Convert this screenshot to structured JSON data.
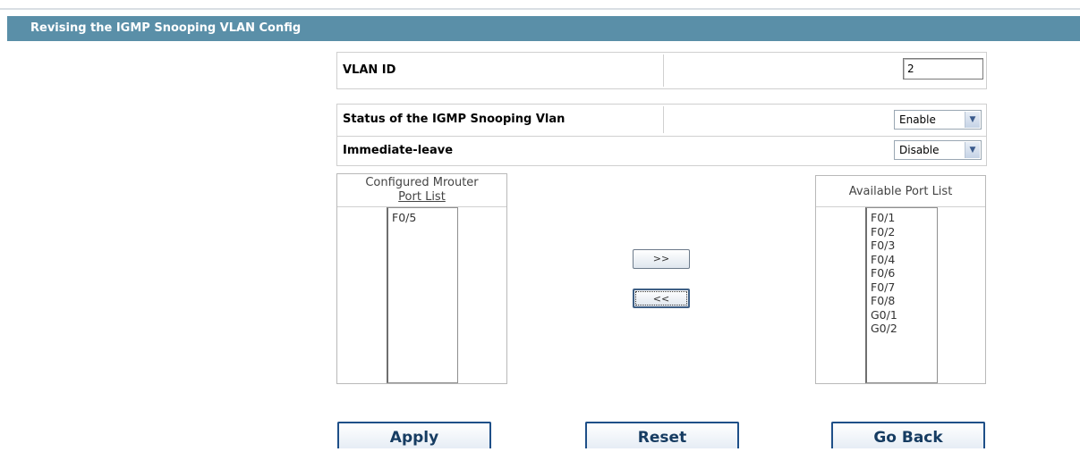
{
  "header": {
    "title": "Revising the IGMP Snooping VLAN Config"
  },
  "vlan": {
    "label": "VLAN ID",
    "value": "2"
  },
  "settings": {
    "status_label": "Status of the IGMP Snooping Vlan",
    "status_value": "Enable",
    "immediate_leave_label": "Immediate-leave",
    "immediate_leave_value": "Disable"
  },
  "configured_list": {
    "title_line1": "Configured Mrouter",
    "title_line2": "Port List",
    "items": [
      "F0/5"
    ]
  },
  "available_list": {
    "title": "Available Port List",
    "items": [
      "F0/1",
      "F0/2",
      "F0/3",
      "F0/4",
      "F0/6",
      "F0/7",
      "F0/8",
      "G0/1",
      "G0/2"
    ]
  },
  "move_buttons": {
    "add_label": ">>",
    "remove_label": "<<"
  },
  "actions": {
    "apply": "Apply",
    "reset": "Reset",
    "go_back": "Go Back"
  }
}
